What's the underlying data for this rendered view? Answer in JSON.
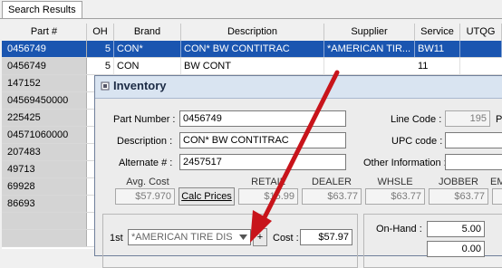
{
  "tab": {
    "label": "Search Results"
  },
  "grid": {
    "columns": [
      "Part #",
      "OH",
      "Brand",
      "Description",
      "Supplier",
      "Service",
      "UTQG"
    ],
    "rows": [
      {
        "part": "0456749",
        "oh": "5",
        "brand": "CON*",
        "description": "CON* BW CONTITRAC",
        "supplier": "*AMERICAN TIR...",
        "service": "BW11",
        "utqg": ""
      },
      {
        "part": "0456749",
        "oh": "5",
        "brand": "CON",
        "description": "BW CONT",
        "supplier": "",
        "service": "11",
        "utqg": ""
      },
      {
        "part": "147152"
      },
      {
        "part": "04569450000"
      },
      {
        "part": "225425"
      },
      {
        "part": "04571060000"
      },
      {
        "part": "207483"
      },
      {
        "part": "49713"
      },
      {
        "part": "69928"
      },
      {
        "part": "86693"
      }
    ]
  },
  "dialog": {
    "title": "Inventory",
    "part_number_label": "Part Number :",
    "part_number": "0456749",
    "description_label": "Description :",
    "description": "CON* BW CONTITRAC",
    "alternate_label": "Alternate # :",
    "alternate": "2457517",
    "line_code_label": "Line Code :",
    "line_code": "195",
    "p_label": "P",
    "upc_label": "UPC code :",
    "upc": "",
    "other_info_label": "Other Information :",
    "other_info": "",
    "avg_cost_label": "Avg. Cost",
    "avg_cost": "$57.970",
    "calc_prices_label": "Calc Prices",
    "price_headers": [
      "RETAIL",
      "DEALER",
      "WHSLE",
      "JOBBER",
      "EM"
    ],
    "prices": [
      "$15.99",
      "$63.77",
      "$63.77",
      "$63.77",
      ""
    ],
    "first_label": "1st",
    "supplier_select": "*AMERICAN TIRE DIS",
    "plus_label": "+",
    "cost_label": "Cost :",
    "cost": "$57.97",
    "on_hand_label": "On-Hand :",
    "on_hand": "5.00",
    "on_hand_2": "0.00"
  },
  "colors": {
    "selection": "#1a55b0",
    "annotation_arrow": "#c8141b"
  }
}
